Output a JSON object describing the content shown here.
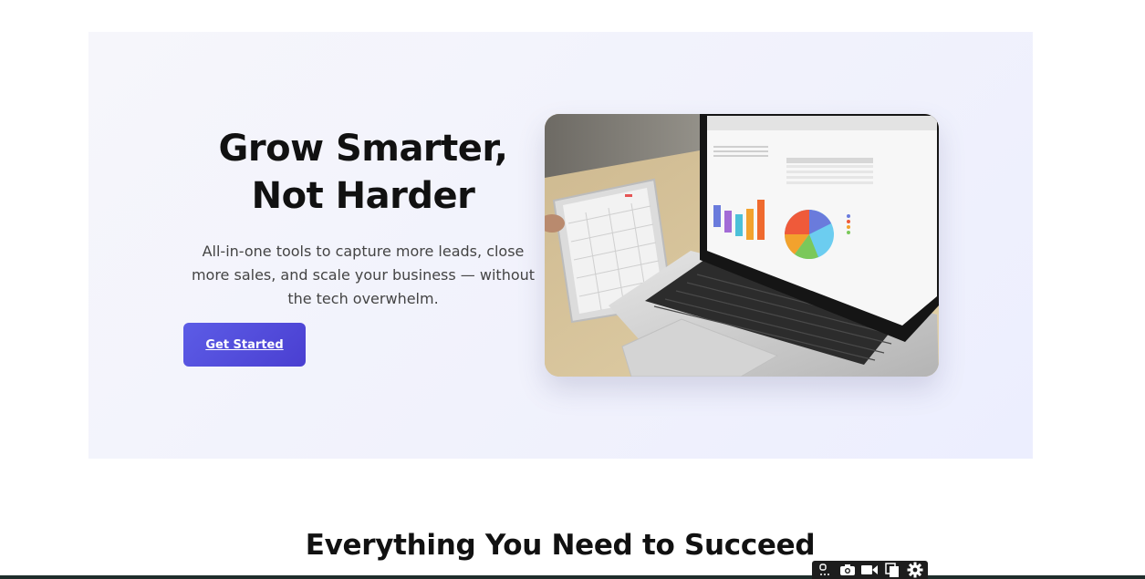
{
  "hero": {
    "title_line1": "Grow Smarter,",
    "title_line2": "Not Harder",
    "subtitle": "All-in-one tools to capture more leads, close more sales, and scale your business — without the tech overwhelm.",
    "cta_label": "Get Started",
    "image_icon": "laptop-tablet-analytics-photo"
  },
  "features": {
    "title": "Everything You Need to Succeed"
  },
  "toolbar": {
    "icons": [
      "link-icon",
      "camera-icon",
      "video-icon",
      "copy-icon",
      "gear-icon"
    ]
  },
  "colors": {
    "accent": "#5b5be6",
    "accent_dark": "#4a3fd1",
    "hero_bg": "#f3f3fc",
    "heading": "#111111",
    "bottom_bar": "#1f2d2b"
  }
}
